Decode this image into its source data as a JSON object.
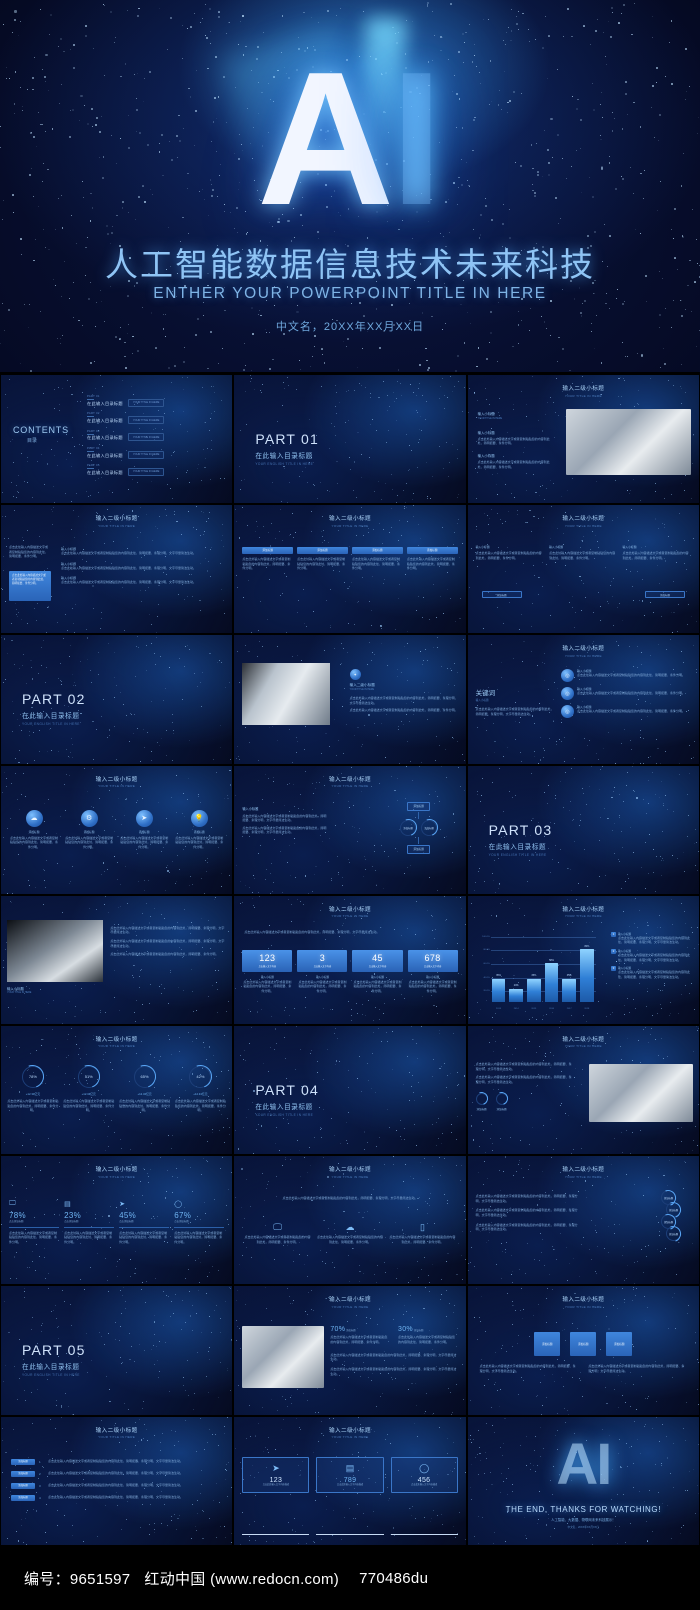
{
  "hero": {
    "logo_a": "A",
    "logo_i": "I",
    "title_cn": "人工智能数据信息技术未来科技",
    "title_en": "ENTHER YOUR POWERPOINT TITLE IN HERE",
    "date_line": "中文名，20XX年XX月XX日"
  },
  "common": {
    "head_cn": "输入二级小标题",
    "head_en": "YOUR TITLE IN HERE",
    "body_cn": "点击此处输入内容描述文字或者复制粘贴您的内容到此处，简明扼要、条件分明。",
    "body_cn2": "点击此处输入内容描述文字或者复制粘贴您的内容到此处，简明扼要、条理分明，文字尽量简洁生动。",
    "sub_label": "输入小标题",
    "en_sub": "YOUR TITLE IN HERE",
    "add_label": "添加标题"
  },
  "contents": {
    "word": "CONTENTS",
    "word_cn": "目录",
    "items": [
      {
        "part": "PART 01",
        "cn": "在此输入目录标题",
        "en": "YOUR TITLE IN HERE"
      },
      {
        "part": "PART 02",
        "cn": "在此输入目录标题",
        "en": "YOUR TITLE IN HERE"
      },
      {
        "part": "PART 03",
        "cn": "在此输入目录标题",
        "en": "YOUR TITLE IN HERE"
      },
      {
        "part": "PART 04",
        "cn": "在此输入目录标题",
        "en": "YOUR TITLE IN HERE"
      },
      {
        "part": "PART 05",
        "cn": "在此输入目录标题",
        "en": "YOUR TITLE IN HERE"
      }
    ]
  },
  "parts": [
    {
      "no": "PART 01",
      "cn": "在此输入目录标题",
      "en": "YOUR ENGLISH TITLE IN HERE"
    },
    {
      "no": "PART 02",
      "cn": "在此输入目录标题",
      "en": "YOUR ENGLISH TITLE IN HERE"
    },
    {
      "no": "PART 03",
      "cn": "在此输入目录标题",
      "en": "YOUR ENGLISH TITLE IN HERE"
    },
    {
      "no": "PART 04",
      "cn": "在此输入目录标题",
      "en": "YOUR ENGLISH TITLE IN HERE"
    },
    {
      "no": "PART 05",
      "cn": "在此输入目录标题",
      "en": "YOUR ENGLISH TITLE IN HERE"
    }
  ],
  "keyword_slide": {
    "title": "关键词",
    "title_en": "输入小标题",
    "items": [
      "输入小标题",
      "输入小标题",
      "输入小标题"
    ]
  },
  "percent_slide": {
    "values": [
      "78%",
      "23%",
      "45%",
      "67%"
    ],
    "sub": "点击添加标题",
    "icons": [
      "monitor-icon",
      "calendar-icon",
      "rocket-icon",
      "search-icon"
    ]
  },
  "ring_slide": {
    "values": [
      "78%",
      "51%",
      "65%",
      "42%"
    ],
    "captions": [
      "+12.34亿元",
      "+12.34亿元",
      "+12.34亿元",
      "+12.34亿元"
    ]
  },
  "stat_boxes_slide": {
    "values": [
      "123",
      "3",
      "45",
      "678"
    ],
    "subs": [
      "点击输入文字内容",
      "点击输入文字内容",
      "点击输入文字内容",
      "点击输入文字内容"
    ]
  },
  "stat_icons_slide": {
    "values": [
      "123",
      "789",
      "456"
    ],
    "subs": [
      "点击此处输入文字内容描述",
      "点击此处输入文字内容描述",
      "点击此处输入文字内容描述"
    ],
    "icons": [
      "send-icon",
      "list-icon",
      "search-icon"
    ]
  },
  "split_slide": {
    "left_pct": "70%",
    "right_pct": "30%",
    "left_label": "添加标题",
    "right_label": "添加标题"
  },
  "circle_icons_slide": {
    "labels": [
      "添加标题",
      "添加标题",
      "添加标题",
      "添加标题"
    ],
    "icons": [
      "cloud-icon",
      "gear-icon",
      "rocket-icon",
      "bulb-icon"
    ]
  },
  "chart_data": {
    "type": "bar",
    "title": "输入二级小标题",
    "subtitle": "YOUR TITLE IN HERE",
    "categories": [
      "2013",
      "2014",
      "2015",
      "2016",
      "2017",
      "2018"
    ],
    "values": [
      35,
      20,
      35,
      58,
      35,
      80
    ],
    "value_labels": [
      "35%",
      "20%",
      "35%",
      "58%",
      "35%",
      "80%"
    ],
    "ylabel": "",
    "xlabel": "",
    "ytick_labels": [
      "100.0%",
      "80.0%",
      "60.0%",
      "40.0%",
      "20.0%"
    ],
    "ylim": [
      0,
      100
    ],
    "grid": true,
    "legend": "none",
    "series_color": "#4f9fe0"
  },
  "end_slide": {
    "logo": "AI",
    "title": "THE END, THANKS FOR WATCHING!",
    "cn": "人工智能、大数据、物联网未来科技展示！",
    "date": "中文名，20XX年XX月XX日"
  },
  "footer": {
    "code_label": "编号：9651597",
    "site": "红动中国 (www.redocn.com)",
    "sku": "770486du"
  },
  "colors": {
    "accent": "#3f86dd",
    "bg": "#060d28",
    "text": "#9dc4ee",
    "glow": "#59a6f5"
  }
}
